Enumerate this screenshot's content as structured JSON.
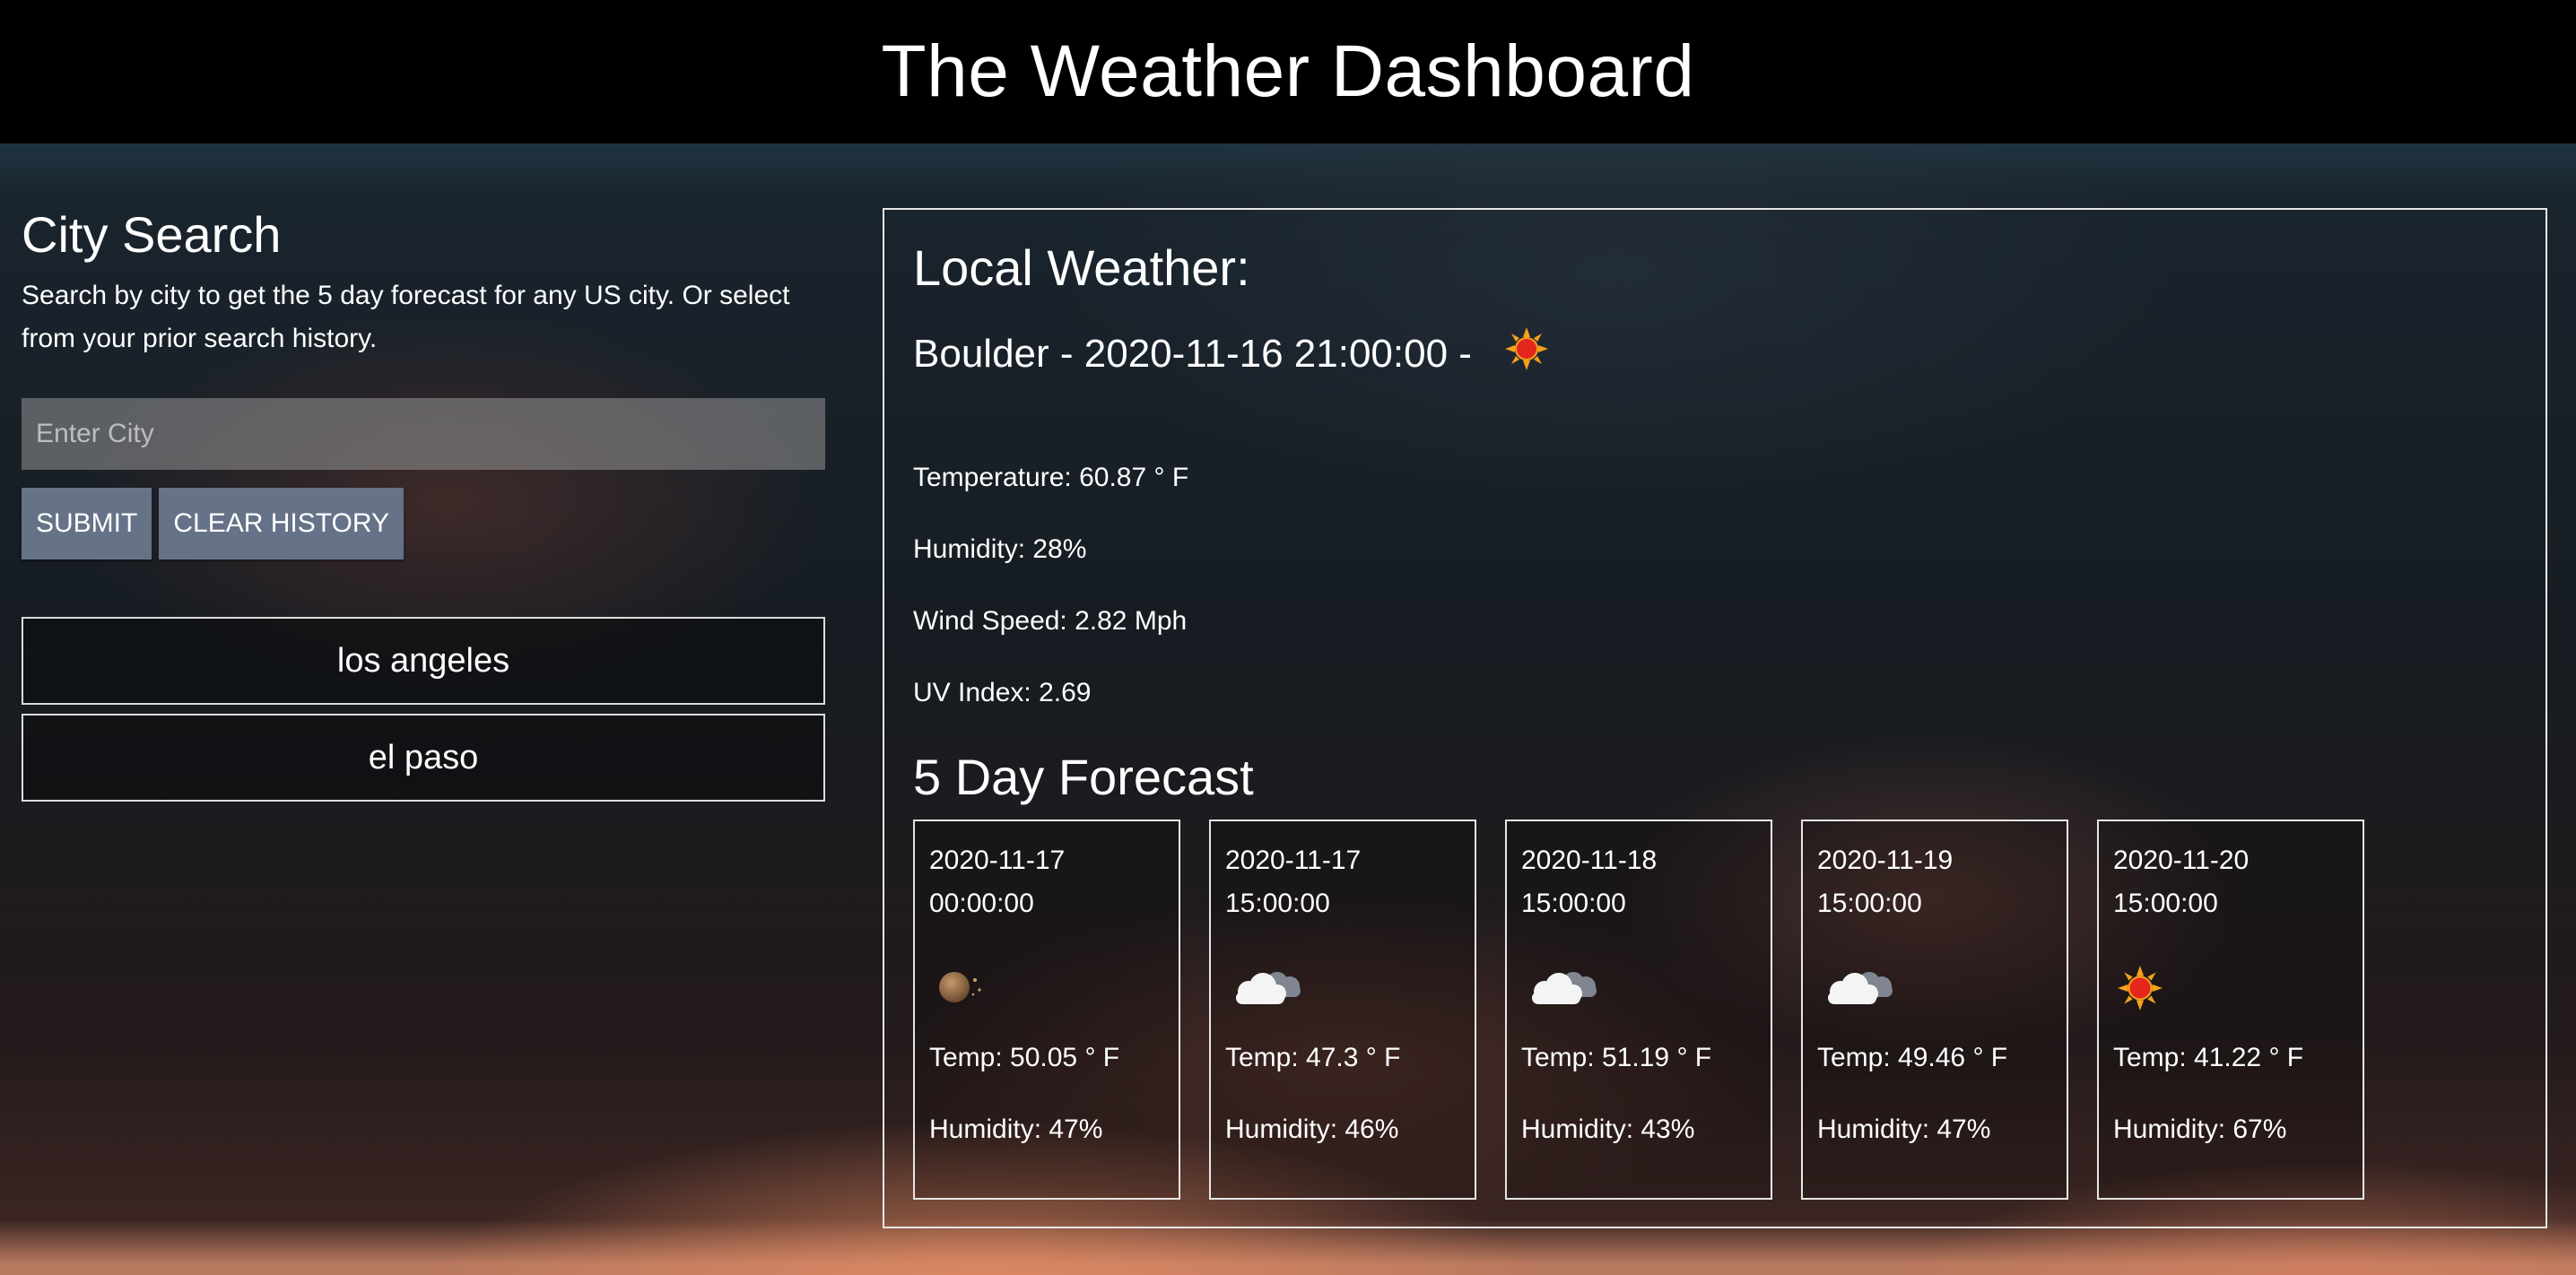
{
  "header": {
    "title": "The Weather Dashboard"
  },
  "search": {
    "heading": "City Search",
    "description": "Search by city to get the 5 day forecast for any US city. Or select from your prior search history.",
    "placeholder": "Enter City",
    "value": "",
    "submit_label": "SUBMIT",
    "clear_label": "CLEAR HISTORY",
    "history": [
      "los angeles",
      "el paso"
    ]
  },
  "local": {
    "heading": "Local Weather:",
    "city_line": "Boulder - 2020-11-16 21:00:00 -",
    "icon": "sun-icon",
    "temperature": "Temperature: 60.87 ° F",
    "humidity": "Humidity: 28%",
    "wind": "Wind Speed: 2.82 Mph",
    "uv": "UV Index: 2.69"
  },
  "forecast": {
    "heading": "5 Day Forecast",
    "days": [
      {
        "date": "2020-11-17 00:00:00",
        "icon": "clear-night-icon",
        "temp": "Temp: 50.05 ° F",
        "humidity": "Humidity: 47%"
      },
      {
        "date": "2020-11-17 15:00:00",
        "icon": "cloud-icon",
        "temp": "Temp: 47.3 ° F",
        "humidity": "Humidity: 46%"
      },
      {
        "date": "2020-11-18 15:00:00",
        "icon": "cloud-icon",
        "temp": "Temp: 51.19 ° F",
        "humidity": "Humidity: 43%"
      },
      {
        "date": "2020-11-19 15:00:00",
        "icon": "cloud-icon",
        "temp": "Temp: 49.46 ° F",
        "humidity": "Humidity: 47%"
      },
      {
        "date": "2020-11-20 15:00:00",
        "icon": "sun-icon",
        "temp": "Temp: 41.22 ° F",
        "humidity": "Humidity: 67%"
      }
    ]
  }
}
